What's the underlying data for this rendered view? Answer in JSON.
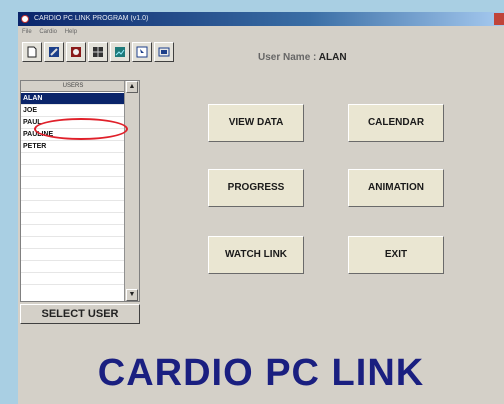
{
  "window": {
    "title": "CARDIO PC LINK PROGRAM (v1.0)",
    "menu": [
      "File",
      "Cardio",
      "Help"
    ]
  },
  "toolbar": {
    "icons": [
      "new-document-icon",
      "tools-icon",
      "heart-monitor-icon",
      "grid-icon",
      "chart-icon",
      "pointer-icon",
      "display-icon"
    ],
    "username_label": "User Name :",
    "username_value": "ALAN"
  },
  "users": {
    "header": "USERS",
    "items": [
      "ALAN",
      "JOE",
      "PAUL",
      "PAULINE",
      "PETER"
    ],
    "selected": "ALAN",
    "select_button": "SELECT USER"
  },
  "actions": {
    "view_data": "VIEW DATA",
    "calendar": "CALENDAR",
    "progress": "PROGRESS",
    "animation": "ANIMATION",
    "watch_link": "WATCH LINK",
    "exit": "EXIT"
  },
  "brand": "CARDIO PC LINK",
  "colors": {
    "selection": "#0a246a",
    "highlight_ring": "#e0202a",
    "brand": "#1a1f80"
  }
}
